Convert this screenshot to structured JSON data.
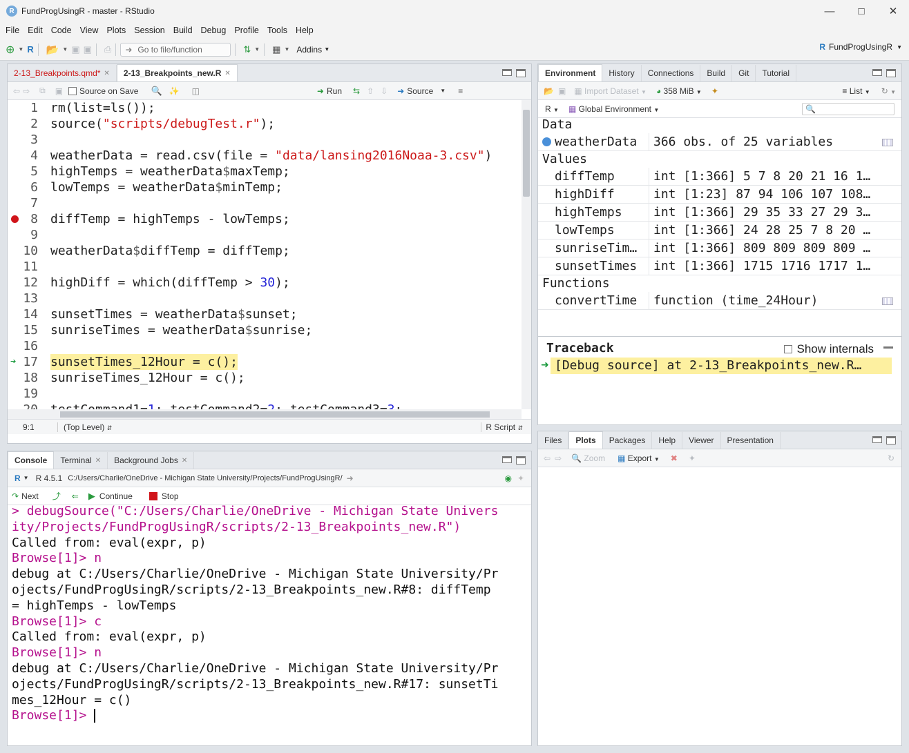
{
  "window": {
    "title": "FundProgUsingR - master - RStudio",
    "logo": "R"
  },
  "menu": [
    "File",
    "Edit",
    "Code",
    "View",
    "Plots",
    "Session",
    "Build",
    "Debug",
    "Profile",
    "Tools",
    "Help"
  ],
  "toolbar": {
    "goto_placeholder": "Go to file/function",
    "addins": "Addins",
    "project": "FundProgUsingR"
  },
  "source_pane": {
    "tabs": [
      {
        "label": "2-13_Breakpoints.qmd*",
        "active": false,
        "color": "#cc1a1a"
      },
      {
        "label": "2-13_Breakpoints_new.R",
        "active": true
      }
    ],
    "toolbar": {
      "source_on_save": "Source on Save",
      "run": "Run",
      "source": "Source"
    },
    "breakpoint_line": 8,
    "current_line": 17,
    "lines": [
      [
        [
          "rm(list=ls());",
          ""
        ]
      ],
      [
        [
          "source(",
          ""
        ],
        [
          "\"scripts/debugTest.r\"",
          "str"
        ],
        [
          ");",
          ""
        ]
      ],
      [],
      [
        [
          "weatherData = read.csv(file = ",
          ""
        ],
        [
          "\"data/lansing2016Noaa-3.csv\"",
          "str"
        ],
        [
          ")",
          ""
        ]
      ],
      [
        [
          "highTemps = weatherData",
          ""
        ],
        [
          "$",
          "op"
        ],
        [
          "maxTemp;",
          ""
        ]
      ],
      [
        [
          "lowTemps = weatherData",
          ""
        ],
        [
          "$",
          "op"
        ],
        [
          "minTemp;",
          ""
        ]
      ],
      [],
      [
        [
          "diffTemp = highTemps - lowTemps;",
          ""
        ]
      ],
      [],
      [
        [
          "weatherData",
          ""
        ],
        [
          "$",
          "op"
        ],
        [
          "diffTemp = diffTemp;",
          ""
        ]
      ],
      [],
      [
        [
          "highDiff = which(diffTemp > ",
          ""
        ],
        [
          "30",
          "num"
        ],
        [
          ");",
          ""
        ]
      ],
      [],
      [
        [
          "sunsetTimes = weatherData",
          ""
        ],
        [
          "$",
          "op"
        ],
        [
          "sunset;",
          ""
        ]
      ],
      [
        [
          "sunriseTimes = weatherData",
          ""
        ],
        [
          "$",
          "op"
        ],
        [
          "sunrise;",
          ""
        ]
      ],
      [],
      [
        [
          "sunsetTimes_12Hour = c();",
          ""
        ]
      ],
      [
        [
          "sunriseTimes_12Hour = c();",
          ""
        ]
      ],
      [],
      [
        [
          "testCommand1=",
          ""
        ],
        [
          "1",
          "num"
        ],
        [
          "; testCommand2=",
          ""
        ],
        [
          "2",
          "num"
        ],
        [
          "; testCommand3=",
          ""
        ],
        [
          "3",
          "num"
        ],
        [
          ";",
          ""
        ]
      ],
      []
    ],
    "status": {
      "position": "9:1",
      "scope": "(Top Level)",
      "filetype": "R Script"
    }
  },
  "console_pane": {
    "tabs": [
      {
        "label": "Console",
        "active": true
      },
      {
        "label": "Terminal"
      },
      {
        "label": "Background Jobs"
      }
    ],
    "r_version": "R 4.5.1",
    "working_dir": "C:/Users/Charlie/OneDrive - Michigan State University/Projects/FundProgUsingR/",
    "debug_toolbar": {
      "next": "Next",
      "continue": "Continue",
      "stop": "Stop"
    },
    "lines": [
      {
        "type": "prompt",
        "prefix": "> ",
        "text": "debugSource(\"C:/Users/Charlie/OneDrive - Michigan State Univers"
      },
      {
        "type": "prompt",
        "prefix": "",
        "text": "ity/Projects/FundProgUsingR/scripts/2-13_Breakpoints_new.R\")"
      },
      {
        "type": "out",
        "text": "Called from: eval(expr, p)"
      },
      {
        "type": "prompt",
        "prefix": "Browse[1]> ",
        "text": "n"
      },
      {
        "type": "out",
        "text": "debug at C:/Users/Charlie/OneDrive - Michigan State University/Pr"
      },
      {
        "type": "out",
        "text": "ojects/FundProgUsingR/scripts/2-13_Breakpoints_new.R#8: diffTemp"
      },
      {
        "type": "out",
        "text": "= highTemps - lowTemps"
      },
      {
        "type": "prompt",
        "prefix": "Browse[1]> ",
        "text": "c"
      },
      {
        "type": "out",
        "text": "Called from: eval(expr, p)"
      },
      {
        "type": "prompt",
        "prefix": "Browse[1]> ",
        "text": "n"
      },
      {
        "type": "out",
        "text": "debug at C:/Users/Charlie/OneDrive - Michigan State University/Pr"
      },
      {
        "type": "out",
        "text": "ojects/FundProgUsingR/scripts/2-13_Breakpoints_new.R#17: sunsetTi"
      },
      {
        "type": "out",
        "text": "mes_12Hour = c()"
      },
      {
        "type": "prompt",
        "prefix": "Browse[1]> ",
        "text": "",
        "cursor": true
      }
    ]
  },
  "env_pane": {
    "tabs": [
      {
        "label": "Environment",
        "active": true
      },
      {
        "label": "History"
      },
      {
        "label": "Connections"
      },
      {
        "label": "Build"
      },
      {
        "label": "Git"
      },
      {
        "label": "Tutorial"
      }
    ],
    "toolbar": {
      "import_dataset": "Import Dataset",
      "memory": "358 MiB",
      "view_mode": "List",
      "language": "R",
      "scope": "Global Environment"
    },
    "sections": [
      {
        "title": "Data",
        "rows": [
          {
            "name": "weatherData",
            "value": "366 obs. of 25 variables",
            "expand": true,
            "grid": true
          }
        ]
      },
      {
        "title": "Values",
        "rows": [
          {
            "name": "diffTemp",
            "value": "int [1:366] 5 7 8 20 21 16 1…"
          },
          {
            "name": "highDiff",
            "value": "int [1:23] 87 94 106 107 108…"
          },
          {
            "name": "highTemps",
            "value": "int [1:366] 29 35 33 27 29 3…"
          },
          {
            "name": "lowTemps",
            "value": "int [1:366] 24 28 25 7 8 20 …"
          },
          {
            "name": "sunriseTim…",
            "value": "int [1:366] 809 809 809 809 …"
          },
          {
            "name": "sunsetTimes",
            "value": "int [1:366] 1715 1716 1717 1…"
          }
        ]
      },
      {
        "title": "Functions",
        "rows": [
          {
            "name": "convertTime",
            "value": "function (time_24Hour)",
            "doc": true
          }
        ]
      }
    ],
    "traceback": {
      "title": "Traceback",
      "show_internals": "Show internals",
      "frame": "[Debug source] at 2-13_Breakpoints_new.R…"
    }
  },
  "files_pane": {
    "tabs": [
      {
        "label": "Files"
      },
      {
        "label": "Plots",
        "active": true
      },
      {
        "label": "Packages"
      },
      {
        "label": "Help"
      },
      {
        "label": "Viewer"
      },
      {
        "label": "Presentation"
      }
    ],
    "toolbar": {
      "zoom": "Zoom",
      "export": "Export"
    }
  }
}
